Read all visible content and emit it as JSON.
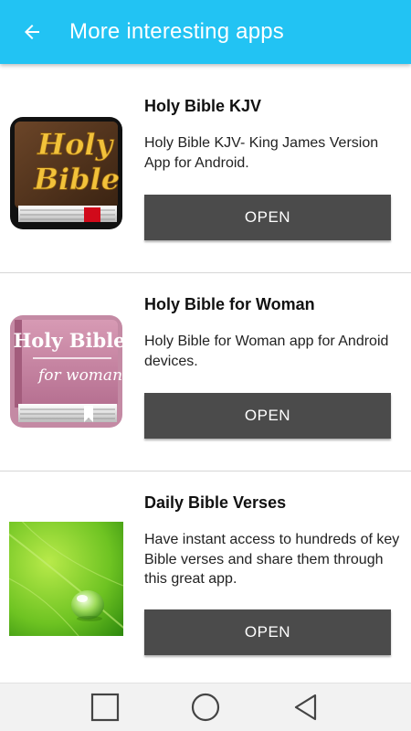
{
  "header": {
    "title": "More interesting apps",
    "back_icon": "arrow-left-icon",
    "color": "#22c3f3"
  },
  "apps": [
    {
      "title": "Holy Bible KJV",
      "description": "Holy Bible KJV- King James Version App for Android.",
      "button_label": "OPEN",
      "icon": "holy-bible-book-icon",
      "icon_text": [
        "Holy",
        "Bible"
      ]
    },
    {
      "title": "Holy Bible for Woman",
      "description": "Holy Bible for Woman app for Android devices.",
      "button_label": "OPEN",
      "icon": "holy-bible-woman-book-icon",
      "icon_text": [
        "Holy Bible",
        "for woman"
      ]
    },
    {
      "title": "Daily Bible Verses",
      "description": "Have instant access to hundreds of key Bible verses and share them through this great app.",
      "button_label": "OPEN",
      "icon": "green-leaf-water-drop-icon"
    }
  ],
  "navbar": {
    "recent_icon": "square-recent-apps-icon",
    "home_icon": "circle-home-icon",
    "back_icon": "triangle-back-icon"
  },
  "colors": {
    "button_bg": "#4b4b4b",
    "button_text": "#ffffff",
    "divider": "#d6d6d6"
  }
}
